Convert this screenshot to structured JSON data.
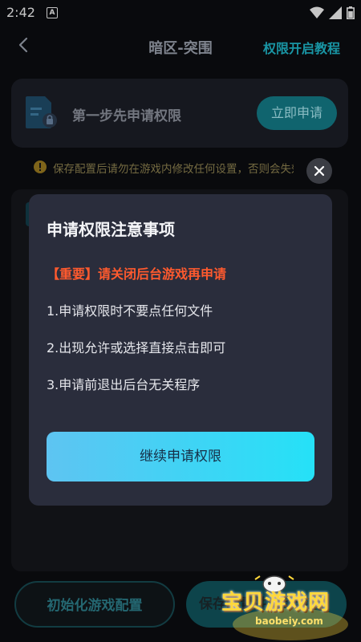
{
  "status": {
    "time": "2:42",
    "notification_letter": "A"
  },
  "header": {
    "title": "暗区-突围",
    "tutorial": "权限开启教程"
  },
  "step": {
    "label": "第一步先申请权限",
    "button": "立即申请"
  },
  "warning": {
    "text": "保存配置后请勿在游戏内修改任何设置，否则会失效"
  },
  "bottom": {
    "init_button": "初始化游戏配置",
    "save_button": "保存配置并启动游戏"
  },
  "dialog": {
    "title": "申请权限注意事项",
    "important": "【重要】请关闭后台游戏再申请",
    "items": [
      "1.申请权限时不要点任何文件",
      "2.出现允许或选择直接点击即可",
      "3.申请前退出后台无关程序"
    ],
    "continue_button": "继续申请权限"
  },
  "watermark": {
    "title": "宝贝游戏网",
    "domain": "baobeiy.com"
  },
  "colors": {
    "accent": "#1fb6c9",
    "important": "#ff5a2e",
    "dialog_bg": "#2a2d3c"
  }
}
